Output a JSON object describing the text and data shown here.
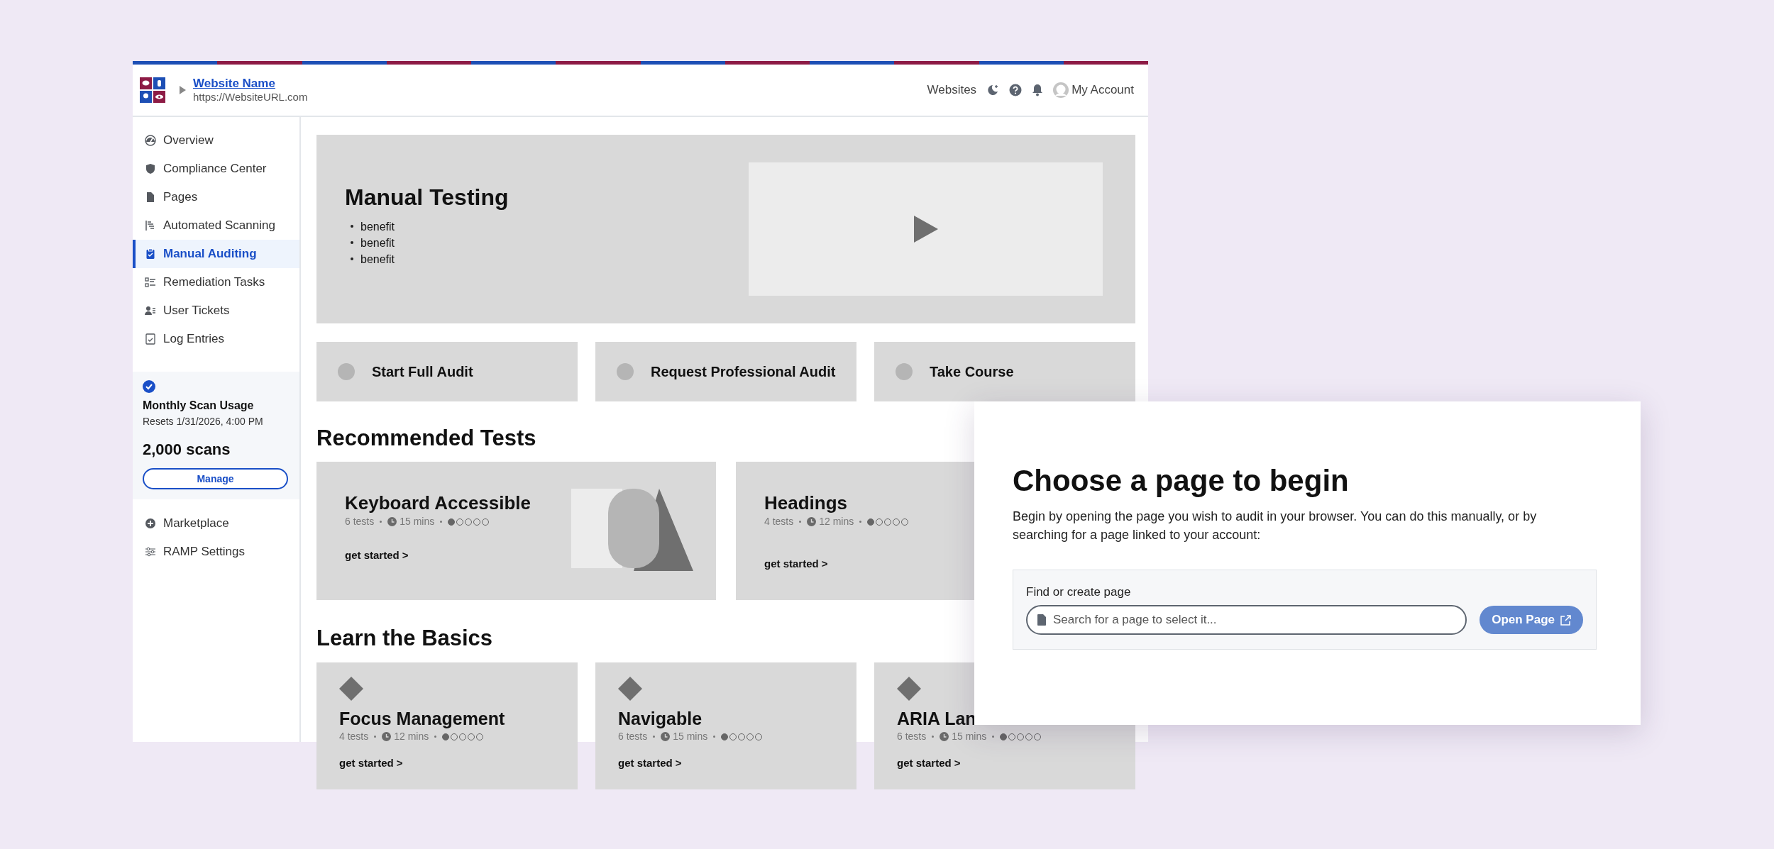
{
  "header": {
    "site_name": "Website Name",
    "site_url": "https://WebsiteURL.com",
    "nav_label": "Websites",
    "account_label": "My Account"
  },
  "sidebar": {
    "items": [
      {
        "label": "Overview",
        "selected": false
      },
      {
        "label": "Compliance Center",
        "selected": false
      },
      {
        "label": "Pages",
        "selected": false
      },
      {
        "label": "Automated Scanning",
        "selected": false
      },
      {
        "label": "Manual Auditing",
        "selected": true
      },
      {
        "label": "Remediation Tasks",
        "selected": false
      },
      {
        "label": "User Tickets",
        "selected": false
      },
      {
        "label": "Log Entries",
        "selected": false
      }
    ],
    "usage": {
      "title": "Monthly Scan Usage",
      "resets": "Resets 1/31/2026, 4:00 PM",
      "count": "2,000 scans",
      "button": "Manage"
    },
    "bottom_items": [
      {
        "label": "Marketplace",
        "selected": false
      },
      {
        "label": "RAMP Settings",
        "selected": false
      }
    ]
  },
  "hero": {
    "title": "Manual Testing",
    "benefits": [
      "benefit",
      "benefit",
      "benefit"
    ]
  },
  "actions": [
    {
      "label": "Start Full Audit"
    },
    {
      "label": "Request Professional Audit"
    },
    {
      "label": "Take Course"
    }
  ],
  "recommended": {
    "title": "Recommended Tests",
    "cards": [
      {
        "title": "Keyboard Accessible",
        "tests": "6 tests",
        "duration": "15 mins",
        "stars": 1,
        "cta": "get started >",
        "art": true
      },
      {
        "title": "Headings",
        "tests": "4 tests",
        "duration": "12 mins",
        "stars": 1,
        "cta": "get started >",
        "art": false
      }
    ]
  },
  "basics": {
    "title": "Learn the Basics",
    "cards": [
      {
        "title": "Focus Management",
        "tests": "4 tests",
        "duration": "12 mins",
        "stars": 1,
        "cta": "get started >"
      },
      {
        "title": "Navigable",
        "tests": "6 tests",
        "duration": "15 mins",
        "stars": 1,
        "cta": "get started >"
      },
      {
        "title": "ARIA Lan",
        "tests": "6 tests",
        "duration": "15 mins",
        "stars": 1,
        "cta": "get started >"
      }
    ]
  },
  "dialog": {
    "title": "Choose a page to begin",
    "text": "Begin by opening the page you wish to audit in your browser. You can do this manually, or by searching for a page linked to your account:",
    "field_label": "Find or create page",
    "placeholder": "Search for a page to select it...",
    "button": "Open Page"
  }
}
